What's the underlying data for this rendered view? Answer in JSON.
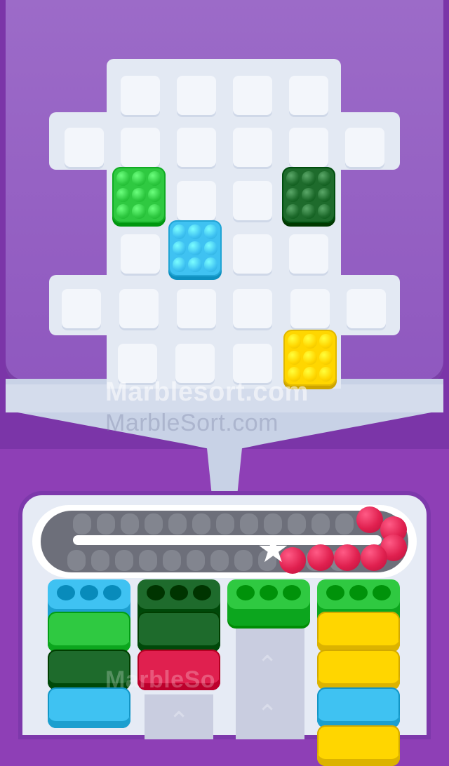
{
  "watermarks": {
    "primary": "Marblesort.com",
    "secondary": "MarbleSort.com",
    "bottom": "MarbleSo"
  },
  "colors": {
    "light_green": "#2fc941",
    "dark_green": "#1e6b2c",
    "cyan": "#3fc2f2",
    "yellow": "#ffd600",
    "red": "#e0204f",
    "purple": "#8e3fb6"
  },
  "board": {
    "blocks": [
      {
        "color": "light_green",
        "name": "green-block"
      },
      {
        "color": "dark_green",
        "name": "dark-green-block"
      },
      {
        "color": "cyan",
        "name": "cyan-block"
      },
      {
        "color": "yellow",
        "name": "yellow-block"
      }
    ]
  },
  "conveyor": {
    "red_marble_count": 7,
    "icon": "star-icon",
    "star_glyph": "★"
  },
  "columns": [
    {
      "head": "cyan",
      "stack": [
        "light_green",
        "dark_green",
        "cyan"
      ]
    },
    {
      "head": "dark_green",
      "stack": [
        "dark_green",
        "red"
      ]
    },
    {
      "head": "light_green",
      "stack": []
    },
    {
      "head": "light_green",
      "stack": [
        "yellow",
        "yellow",
        "cyan",
        "yellow"
      ]
    }
  ],
  "chevron_glyph": "⌃"
}
